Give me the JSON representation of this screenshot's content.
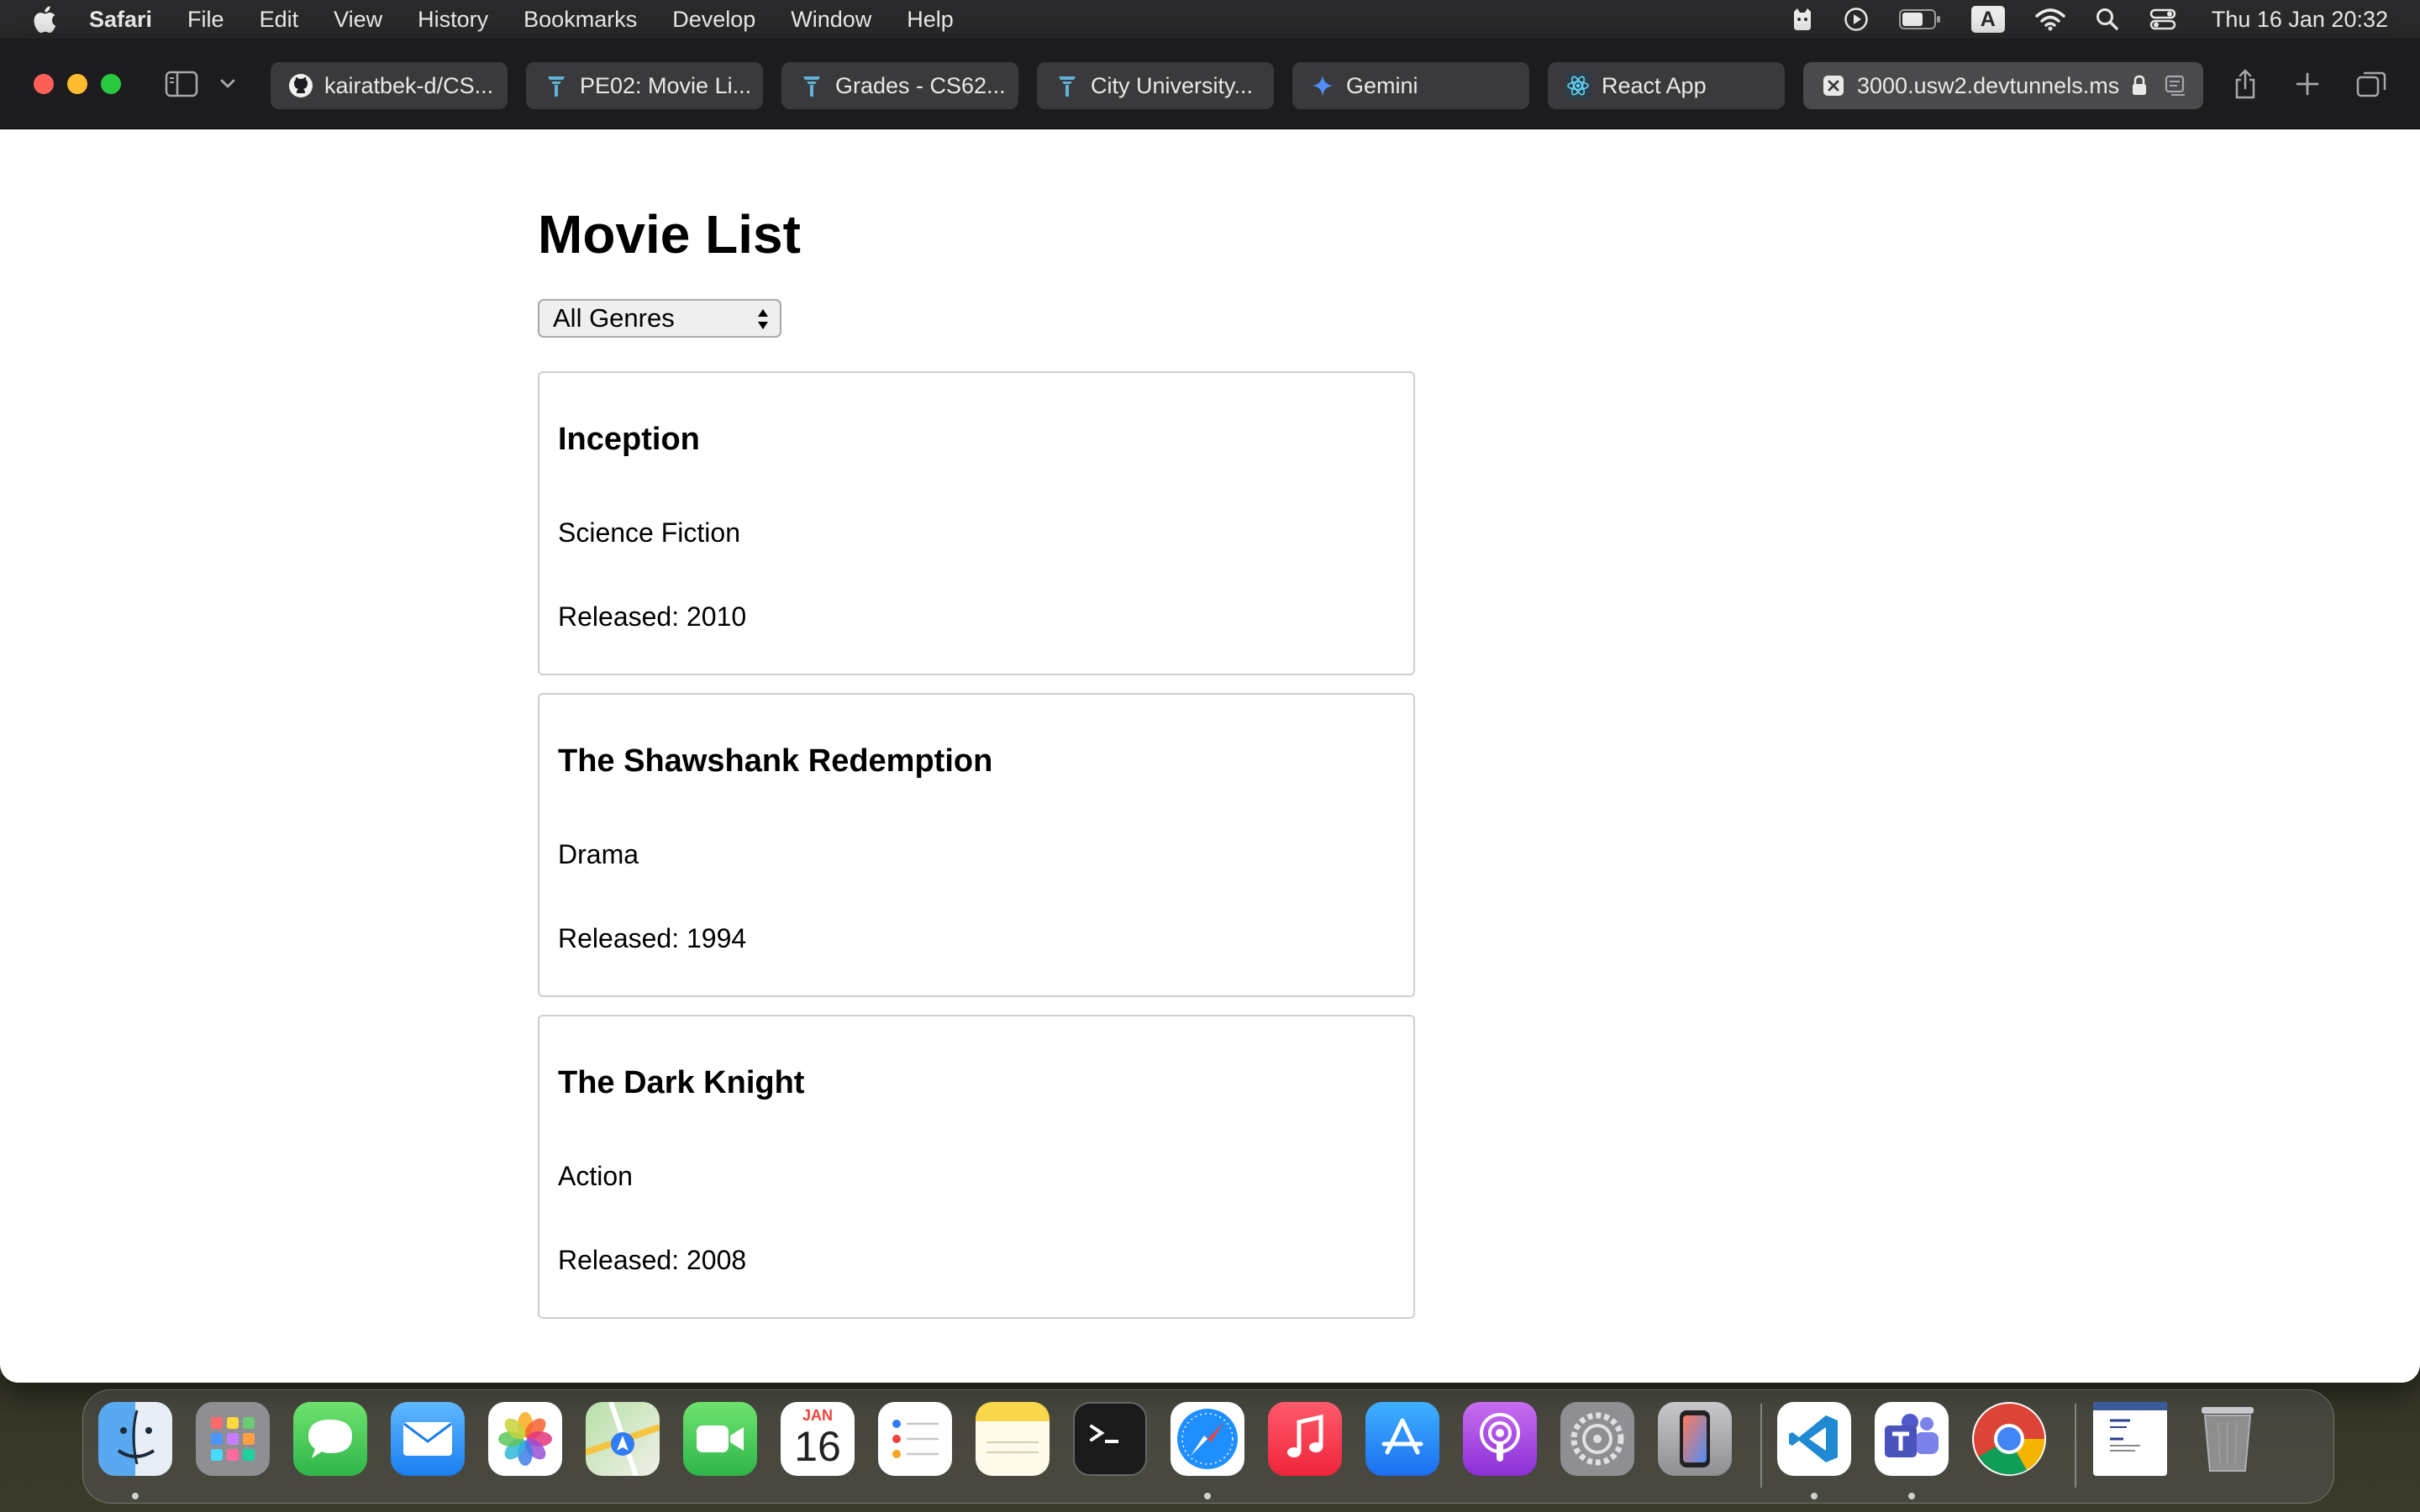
{
  "menubar": {
    "app_name": "Safari",
    "items": [
      "File",
      "Edit",
      "View",
      "History",
      "Bookmarks",
      "Develop",
      "Window",
      "Help"
    ],
    "input_source": "A",
    "clock": "Thu 16 Jan  20:32"
  },
  "tabs": [
    {
      "label": "kairatbek-d/CS...",
      "icon": "github-icon"
    },
    {
      "label": "PE02: Movie Li...",
      "icon": "cityu-icon"
    },
    {
      "label": "Grades - CS62...",
      "icon": "cityu-icon"
    },
    {
      "label": "City University...",
      "icon": "cityu-icon"
    },
    {
      "label": "Gemini",
      "icon": "gemini-icon"
    },
    {
      "label": "React App",
      "icon": "react-icon"
    },
    {
      "label": "3000.usw2.devtunnels.ms",
      "icon": "close-tab-icon",
      "active": true
    }
  ],
  "page": {
    "title": "Movie List",
    "genre_filter": {
      "selected": "All Genres"
    },
    "movies": [
      {
        "title": "Inception",
        "genre": "Science Fiction",
        "released": "Released: 2010"
      },
      {
        "title": "The Shawshank Redemption",
        "genre": "Drama",
        "released": "Released: 1994"
      },
      {
        "title": "The Dark Knight",
        "genre": "Action",
        "released": "Released: 2008"
      }
    ]
  },
  "dock": {
    "calendar_month": "JAN",
    "calendar_day": "16",
    "apps": [
      "finder",
      "launchpad",
      "messages",
      "mail",
      "photos",
      "maps",
      "facetime",
      "calendar",
      "reminders",
      "notes",
      "terminal",
      "safari",
      "music",
      "app-store",
      "podcasts",
      "system-settings",
      "iphone-mirroring",
      "vscode",
      "teams",
      "chrome",
      "document-preview",
      "trash"
    ]
  },
  "colors": {
    "close": "#ff5f57",
    "minimize": "#febc2e",
    "maximize": "#28c840",
    "toolbar": "#1c1c1e",
    "tab": "#3a3a3c"
  }
}
